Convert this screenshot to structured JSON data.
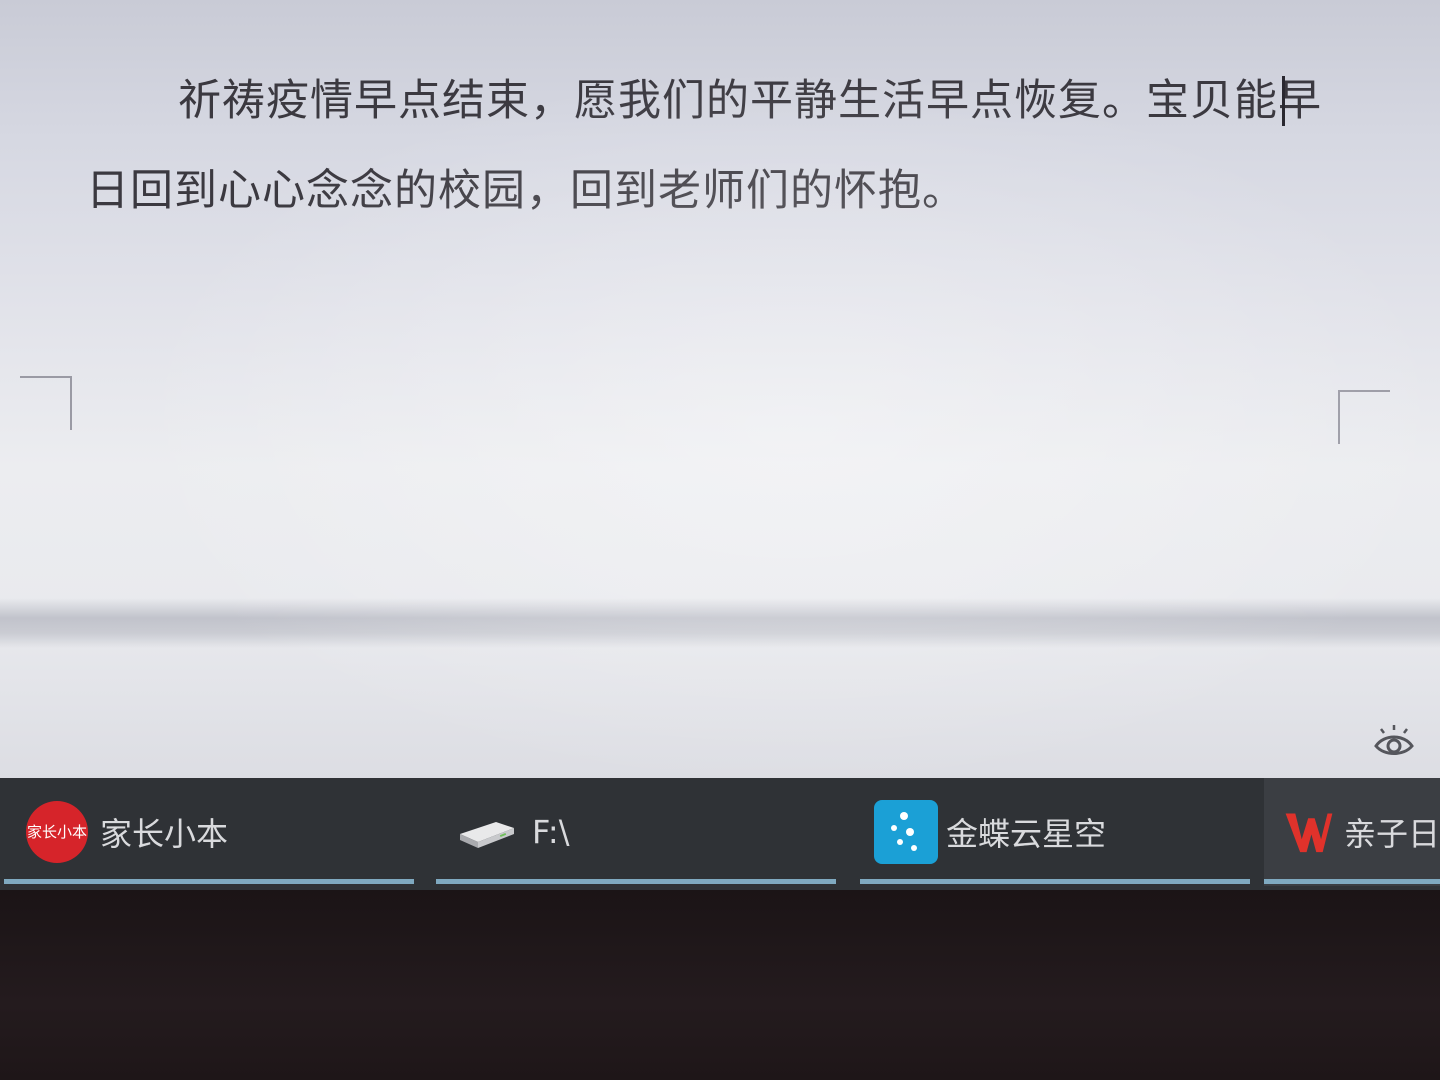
{
  "document": {
    "paragraph": "祈祷疫情早点结束，愿我们的平静生活早点恢复。宝贝能早日回到心心念念的校园，回到老师们的怀抱。"
  },
  "taskbar": {
    "items": [
      {
        "label": "家长小本",
        "icon": "jiazhang-xiaoben-logo",
        "icon_text": "家长小本",
        "active": false
      },
      {
        "label": "F:\\",
        "icon": "drive-icon",
        "active": false
      },
      {
        "label": "金蝶云星空",
        "icon": "kingdee-logo",
        "active": false
      },
      {
        "label": "亲子日",
        "icon": "wps-writer-logo",
        "active": true
      }
    ]
  },
  "colors": {
    "taskbar_bg": "#2f3236",
    "taskbar_underline": "#7fa9c0",
    "jiazhang_red": "#d6242a",
    "kingdee_blue": "#1ba0d6",
    "wps_red": "#e0322b"
  }
}
